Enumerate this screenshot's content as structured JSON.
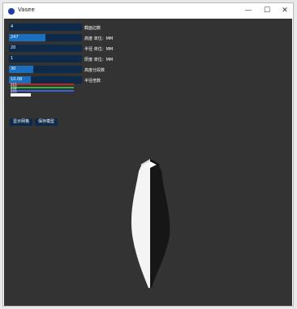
{
  "window": {
    "title": "Vasee",
    "minimize": "—",
    "maximize": "☐",
    "close": "✕"
  },
  "controls": [
    {
      "value": "4",
      "label": "截面边数",
      "fill": 0.0
    },
    {
      "value": "247",
      "label": "高度 单位：MM",
      "fill": 0.5
    },
    {
      "value": "20",
      "label": "半径 单位：MM",
      "fill": 0.0
    },
    {
      "value": "1",
      "label": "厚度 单位：MM",
      "fill": 0.0
    },
    {
      "value": "30",
      "label": "高度分段数",
      "fill": 0.33
    },
    {
      "value": "10.08",
      "label": "半径倍数",
      "fill": 0.3
    }
  ],
  "color": {
    "r": {
      "value": "215",
      "hex": "#c9231d"
    },
    "g": {
      "value": "232",
      "hex": "#2db53a"
    },
    "b": {
      "value": "255",
      "hex": "#3a63e0"
    }
  },
  "buttons": {
    "show_grid": "显示网格",
    "save_model": "保存模型"
  }
}
